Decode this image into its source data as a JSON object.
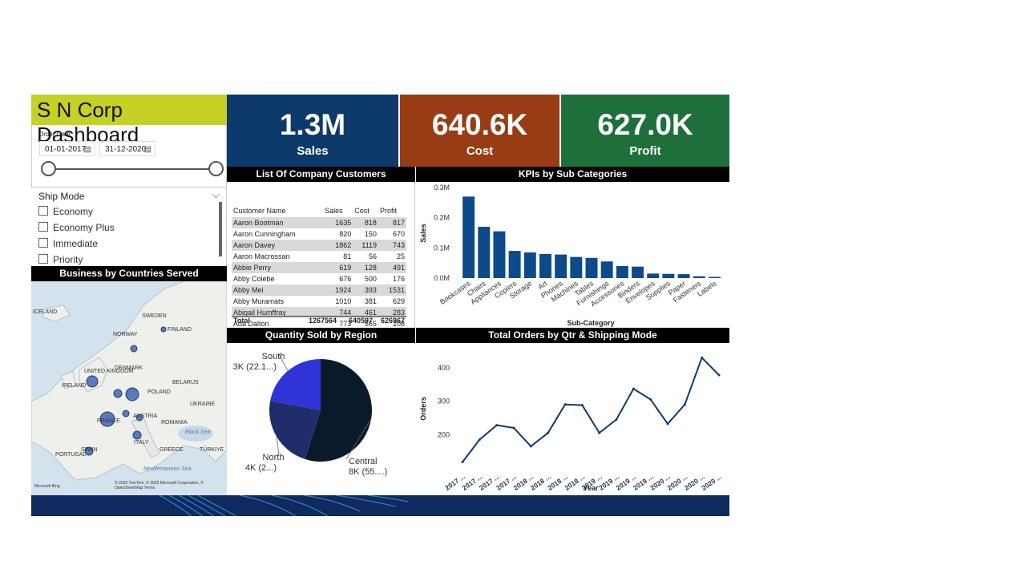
{
  "title": "S N Corp Dashboard",
  "kpis": {
    "sales": {
      "value": "1.3M",
      "label": "Sales",
      "color": "#0d3a6b"
    },
    "cost": {
      "value": "640.6K",
      "label": "Cost",
      "color": "#973c15"
    },
    "profit": {
      "value": "627.0K",
      "label": "Profit",
      "color": "#1e6f3a"
    }
  },
  "order_date": {
    "label": "Order Date",
    "start": "01-01-2017",
    "end": "31-12-2020"
  },
  "ship_mode": {
    "label": "Ship Mode",
    "options": [
      "Economy",
      "Economy Plus",
      "Immediate",
      "Priority"
    ]
  },
  "map": {
    "title": "Business by Countries Served",
    "labels": [
      "ICELAND",
      "SWEDEN",
      "FINLAND",
      "NORWAY",
      "DENMARK",
      "UNITED KINGDOM",
      "IRELAND",
      "POLAND",
      "BELARUS",
      "UKRAINE",
      "FRANCE",
      "AUSTRIA",
      "ROMANIA",
      "ITALY",
      "SPAIN",
      "PORTUGAL",
      "GREECE",
      "TÜRKIYE",
      "Black Sea",
      "Mediterranean Sea"
    ],
    "attribution": "© 2025 TomTom, © 2025 Microsoft Corporation, © OpenStreetMap Terms",
    "brand": "Microsoft Bing"
  },
  "customers": {
    "title": "List Of Company Customers",
    "columns": [
      "Customer Name",
      "Sales",
      "Cost",
      "Profit"
    ],
    "rows": [
      [
        "Aaron Bootman",
        "1635",
        "818",
        "817"
      ],
      [
        "Aaron Cunningham",
        "820",
        "150",
        "670"
      ],
      [
        "Aaron Davey",
        "1862",
        "1119",
        "743"
      ],
      [
        "Aaron Macrossan",
        "81",
        "56",
        "25"
      ],
      [
        "Abbie Perry",
        "619",
        "128",
        "491"
      ],
      [
        "Abby Colebe",
        "676",
        "500",
        "176"
      ],
      [
        "Abby Mei",
        "1924",
        "393",
        "1531"
      ],
      [
        "Abby Muramats",
        "1010",
        "381",
        "629"
      ],
      [
        "Abigail Humffray",
        "744",
        "461",
        "283"
      ],
      [
        "Ada Dalton",
        "773",
        "565",
        "208"
      ]
    ],
    "total": [
      "Total",
      "1267564",
      "640597",
      "626967"
    ]
  },
  "charts": {
    "subcat_title": "KPIs by Sub Categories",
    "region_title": "Quantity Sold by Region",
    "orders_title": "Total Orders by Qtr & Shipping Mode"
  },
  "chart_data": [
    {
      "type": "bar",
      "title": "KPIs by Sub Categories",
      "xlabel": "Sub-Category",
      "ylabel": "Sales",
      "categories": [
        "Bookcases",
        "Chairs",
        "Appliances",
        "Copiers",
        "Storage",
        "Art",
        "Phones",
        "Machines",
        "Tables",
        "Furnishings",
        "Accessories",
        "Binders",
        "Envelopes",
        "Supplies",
        "Paper",
        "Fasteners",
        "Labels"
      ],
      "values": [
        270000,
        170000,
        155000,
        90000,
        85000,
        80000,
        78000,
        70000,
        67000,
        55000,
        40000,
        38000,
        15000,
        14000,
        13000,
        6000,
        4000
      ],
      "ylim": [
        0,
        300000
      ],
      "yticks": [
        "0.0M",
        "0.1M",
        "0.2M",
        "0.3M"
      ],
      "color": "#0d4a8b"
    },
    {
      "type": "pie",
      "title": "Quantity Sold by Region",
      "slices": [
        {
          "name": "Central",
          "value": 8000,
          "percent": 55,
          "label1": "Central",
          "label2": "8K (55....)",
          "color": "#0b1a2b"
        },
        {
          "name": "North",
          "value": 4000,
          "percent": 23,
          "label1": "North",
          "label2": "4K (2...)",
          "color": "#1f2d6b"
        },
        {
          "name": "South",
          "value": 3000,
          "percent": 22.1,
          "label1": "South",
          "label2": "3K (22.1...)",
          "color": "#2f34d8"
        }
      ]
    },
    {
      "type": "line",
      "title": "Total Orders by Qtr & Shipping Mode",
      "xlabel": "Year",
      "ylabel": "Orders",
      "x": [
        "2017 ...",
        "2017 ...",
        "2017 ...",
        "2017 ...",
        "2018 ...",
        "2018 ...",
        "2018 ...",
        "2018 ...",
        "2019 ...",
        "2019 ...",
        "2019 ...",
        "2019 ...",
        "2020 ...",
        "2020 ...",
        "2020 ...",
        "2020 ..."
      ],
      "values": [
        118,
        185,
        228,
        220,
        165,
        205,
        290,
        288,
        205,
        245,
        337,
        305,
        232,
        290,
        430,
        378
      ],
      "ylim": [
        100,
        450
      ],
      "yticks": [
        200,
        300,
        400
      ],
      "color": "#0f3a6b"
    }
  ]
}
